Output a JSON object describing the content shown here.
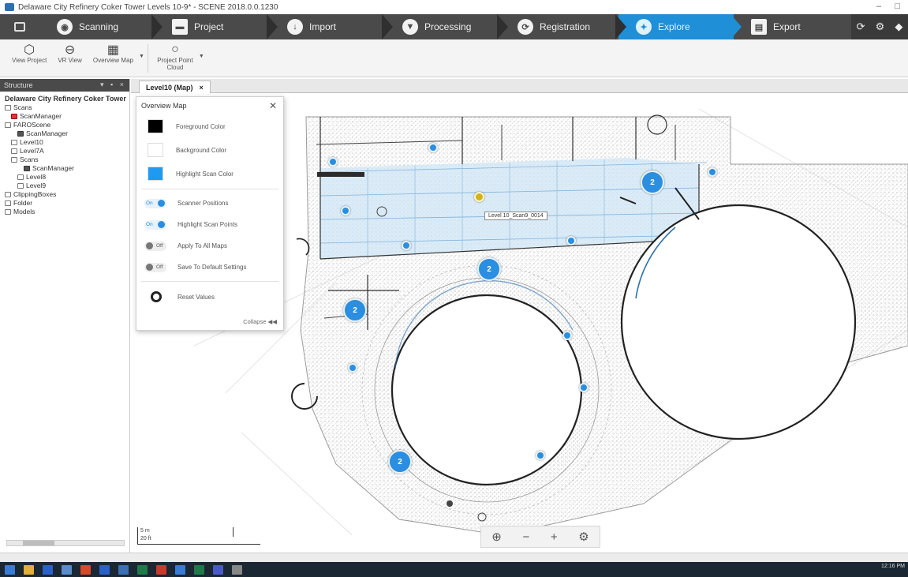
{
  "window": {
    "title": "Delaware City Refinery Coker Tower Levels 10-9* - SCENE 2018.0.0.1230"
  },
  "workflow": {
    "steps": [
      {
        "label": "Scanning",
        "icon": "scanner-icon",
        "active": false
      },
      {
        "label": "Project",
        "icon": "folder-icon",
        "active": false
      },
      {
        "label": "Import",
        "icon": "import-icon",
        "active": false
      },
      {
        "label": "Processing",
        "icon": "processing-icon",
        "active": false
      },
      {
        "label": "Registration",
        "icon": "registration-icon",
        "active": false
      },
      {
        "label": "Explore",
        "icon": "explore-icon",
        "active": true
      },
      {
        "label": "Export",
        "icon": "export-icon",
        "active": false
      }
    ]
  },
  "ribbon": {
    "view_project": "View Project",
    "vr_view": "VR View",
    "overview_map": "Overview Map",
    "project_point_cloud": "Project Point Cloud"
  },
  "structure": {
    "title": "Structure",
    "items": [
      {
        "label": "Delaware City Refinery Coker Tower",
        "level": 0,
        "root": true
      },
      {
        "label": "Scans",
        "level": 0
      },
      {
        "label": "ScanManager",
        "level": 1,
        "mark": "red"
      },
      {
        "label": "FAROScene",
        "level": 0
      },
      {
        "label": "ScanManager",
        "level": 2,
        "mark": "gray"
      },
      {
        "label": "Level10",
        "level": 1
      },
      {
        "label": "Level7A",
        "level": 1
      },
      {
        "label": "Scans",
        "level": 1
      },
      {
        "label": "ScanManager",
        "level": 3,
        "mark": "gray"
      },
      {
        "label": "Level8",
        "level": 2
      },
      {
        "label": "Level9",
        "level": 2
      },
      {
        "label": "ClippingBoxes",
        "level": 0
      },
      {
        "label": "Folder",
        "level": 0
      },
      {
        "label": "Models",
        "level": 0
      }
    ]
  },
  "tab": {
    "label": "Level10 (Map)",
    "close": "×"
  },
  "overview_panel": {
    "title": "Overview Map",
    "foreground_label": "Foreground Color",
    "foreground_color": "#000000",
    "background_label": "Background Color",
    "background_color": "#ffffff",
    "highlight_label": "Highlight Scan Color",
    "highlight_color": "#1e9bf0",
    "toggles": [
      {
        "state": "On",
        "on": true,
        "label": "Scanner Positions"
      },
      {
        "state": "On",
        "on": true,
        "label": "Highlight Scan Points"
      },
      {
        "state": "Off",
        "on": false,
        "label": "Apply To All Maps"
      },
      {
        "state": "Off",
        "on": false,
        "label": "Save To Default Settings"
      }
    ],
    "reset_label": "Reset Values",
    "collapse_label": "Collapse ◀◀"
  },
  "map": {
    "tooltip": "Level 10_Scan9_0014",
    "clusters": [
      "2",
      "2",
      "2",
      "2"
    ],
    "scale_top": "5 m",
    "scale_bottom": "20 ft"
  },
  "tray": {
    "time": "12:16 PM"
  }
}
